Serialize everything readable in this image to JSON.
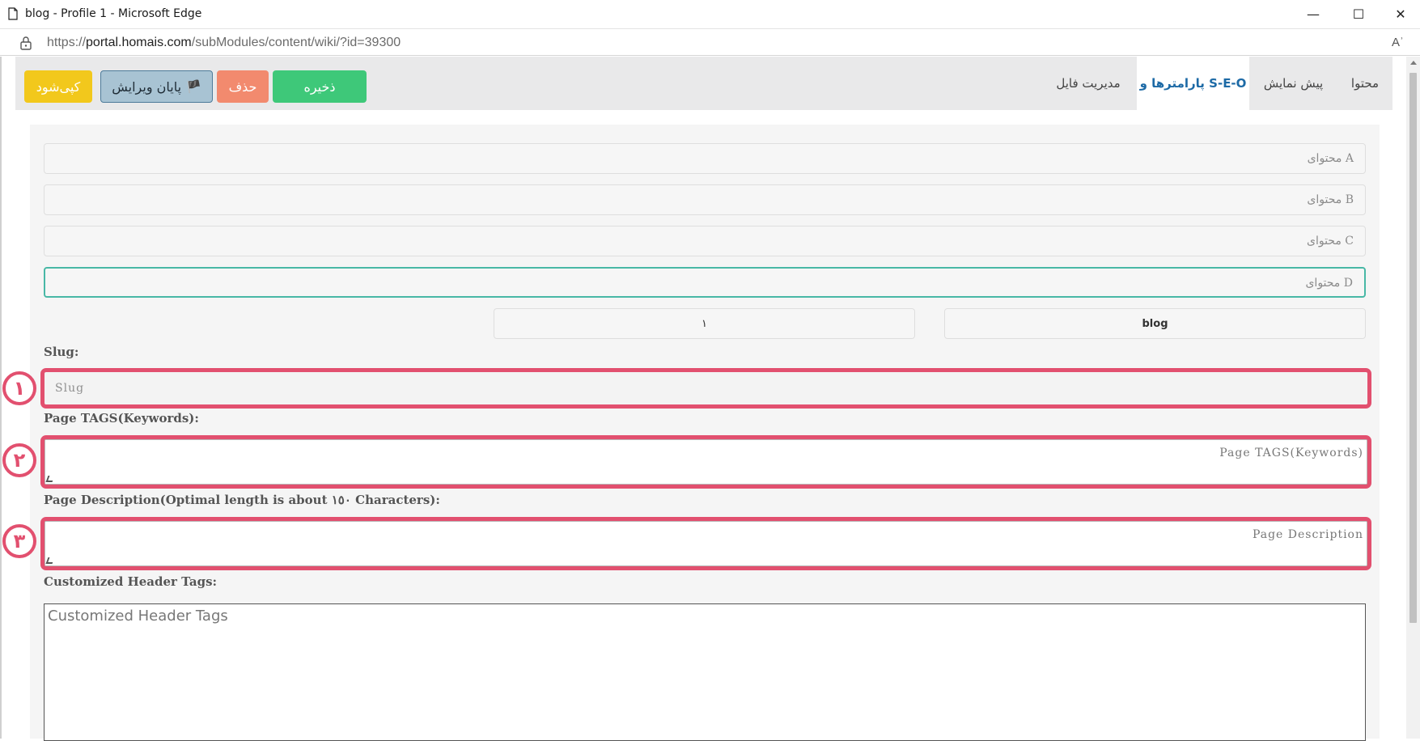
{
  "window": {
    "title": "blog - Profile 1 - Microsoft Edge",
    "minimize": "—",
    "maximize": "☐",
    "close": "✕"
  },
  "address": {
    "url_prefix": "https://",
    "url_host": "portal.homais.com",
    "url_path": "/subModules/content/wiki/?id=39300",
    "read_aloud": "Aʾ"
  },
  "tabs": {
    "content": "محتوا",
    "preview": "پیش نمایش",
    "seo": "پارامترها و S-E-O",
    "files": "مدیریت فایل"
  },
  "buttons": {
    "copy": "کپی‌شود",
    "end_edit": "پایان ویرایش",
    "flag_glyph": "🏴",
    "delete": "حذف",
    "save": "ذخیره"
  },
  "fields": {
    "content_a": "محتوای A",
    "content_b": "محتوای B",
    "content_c": "محتوای C",
    "content_d": "محتوای D",
    "blog": "blog",
    "number": "١"
  },
  "labels": {
    "slug": "Slug:",
    "tags": "Page TAGS(Keywords):",
    "description": "Page Description(Optimal length is about ١٥٠ Characters):",
    "header_tags": "Customized Header Tags:"
  },
  "placeholders": {
    "slug": "Slug",
    "tags": "Page TAGS(Keywords)",
    "description": "Page Description",
    "header_tags": "Customized Header Tags"
  },
  "badges": {
    "one": "١",
    "two": "٢",
    "three": "٣"
  },
  "colors": {
    "highlight": "#e2506f",
    "save": "#3ec879",
    "delete": "#f28a6e",
    "copy": "#f2c81c",
    "end_edit": "#a8c3d3",
    "active_tab_text": "#1d6aa6",
    "focus_border": "#48b8a6"
  }
}
